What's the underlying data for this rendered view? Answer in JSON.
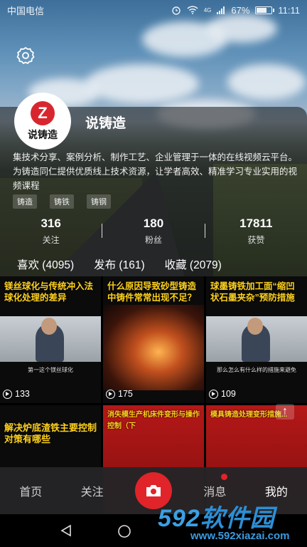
{
  "status_bar": {
    "carrier": "中国电信",
    "signal": "4G",
    "battery": "67%",
    "battery_level": 0.67,
    "time": "11:11"
  },
  "profile": {
    "avatar_text": "说铸造",
    "avatar_mark": "Z",
    "name": "说铸造",
    "bio": "集技术分享、案例分析、制作工艺、企业管理于一体的在线视频云平台。为铸造同仁提供优质线上技术资源，让学者高效、精准学习专业实用的视频课程",
    "tags": [
      "铸造",
      "铸铁",
      "铸钢"
    ],
    "stats": [
      {
        "value": "316",
        "label": "关注"
      },
      {
        "value": "180",
        "label": "粉丝"
      },
      {
        "value": "17811",
        "label": "获赞"
      }
    ]
  },
  "tabs": [
    {
      "label": "喜欢 (4095)"
    },
    {
      "label": "发布 (161)"
    },
    {
      "label": "收藏 (2079)"
    }
  ],
  "videos": [
    {
      "caption": "镁丝球化与传统冲入法球化处理的差异",
      "subtitle": "第一这个镁丝球化",
      "plays": "133"
    },
    {
      "caption": "什么原因导致砂型铸造中铸件常常出现不足？",
      "subtitle": "",
      "plays": "175"
    },
    {
      "caption": "球墨铸铁加工面“缩凹状石墨夹杂”预防措施",
      "subtitle": "那么怎么有什么样的措施来避免",
      "plays": "109"
    },
    {
      "caption": "解决炉底渣铁主要控制对策有哪些",
      "subtitle": "",
      "plays": ""
    },
    {
      "caption": "消失模生产机床件变形与操作控制（下",
      "subtitle": "",
      "plays": ""
    },
    {
      "caption": "模具铸造处理变形措施...",
      "subtitle": "",
      "plays": ""
    }
  ],
  "bottom_nav": {
    "home": "首页",
    "follow": "关注",
    "messages": "消息",
    "mine": "我的"
  },
  "watermark": {
    "brand_num": "592",
    "brand_text": "软件园",
    "url": "www.592xiazai.com"
  },
  "colors": {
    "accent": "#e0242a",
    "caption": "#ffd21f",
    "watermark": "#2c8fd6"
  }
}
